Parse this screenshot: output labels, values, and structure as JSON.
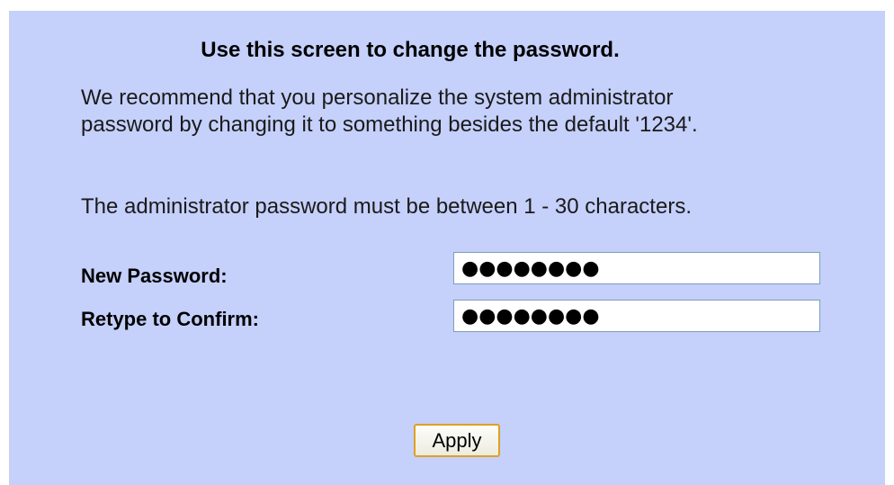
{
  "heading": "Use this screen to change the password.",
  "recommendation": {
    "line1": "We recommend that you personalize the system administrator",
    "line2": "password by changing it to something besides the default '1234'."
  },
  "requirement": "The administrator password must be between 1 - 30 characters.",
  "form": {
    "new_password_label": "New Password:",
    "new_password_value": "●●●●●●●●",
    "confirm_label": "Retype to Confirm:",
    "confirm_value": "●●●●●●●●",
    "apply_label": "Apply"
  },
  "colors": {
    "panel_background": "#c5d0fb",
    "button_border": "#e0a020"
  }
}
